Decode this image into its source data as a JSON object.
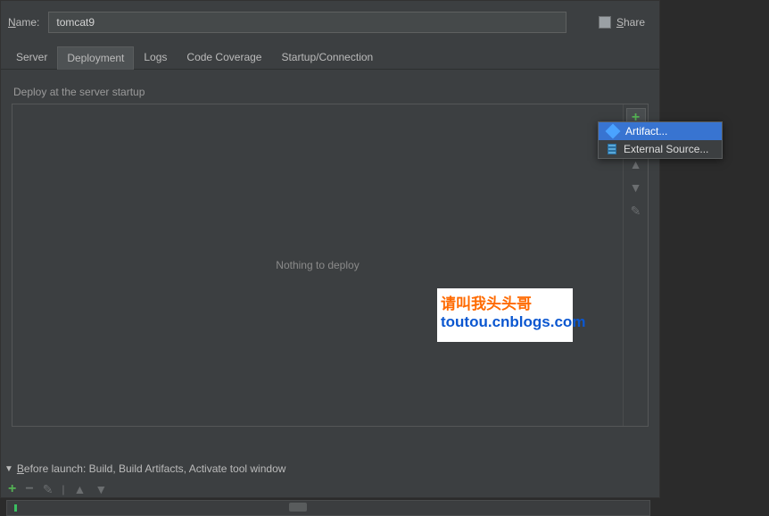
{
  "name_row": {
    "label_pre": "N",
    "label_post": "ame:",
    "value": "tomcat9",
    "share_pre": "S",
    "share_post": "hare"
  },
  "tabs": {
    "server": "Server",
    "deployment": "Deployment",
    "logs": "Logs",
    "coverage": "Code Coverage",
    "startup": "Startup/Connection"
  },
  "deploy": {
    "section_label": "Deploy at the server startup",
    "empty_text": "Nothing to deploy"
  },
  "popup": {
    "artifact": "Artifact...",
    "external": "External Source..."
  },
  "before": {
    "label_pre": "B",
    "label_post": "efore launch: Build, Build Artifacts, Activate tool window"
  },
  "watermark": {
    "line1": "请叫我头头哥",
    "line2": "toutou.cnblogs.com"
  },
  "glyphs": {
    "plus": "+",
    "minus": "−",
    "arrow_up": "▲",
    "arrow_down": "▼",
    "pencil": "✎",
    "triangle": "▼"
  }
}
